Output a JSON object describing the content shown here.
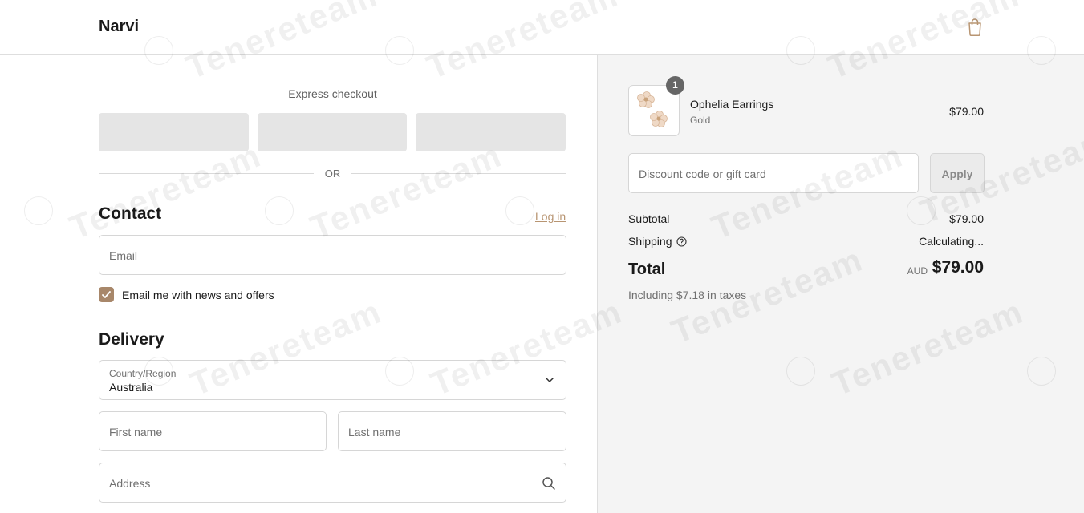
{
  "header": {
    "brand": "Narvi",
    "cart_icon": "shopping-bag-icon"
  },
  "express_checkout": {
    "title": "Express checkout",
    "divider_text": "OR"
  },
  "contact": {
    "title": "Contact",
    "login_link": "Log in",
    "email_placeholder": "Email",
    "newsletter_label": "Email me with news and offers",
    "newsletter_checked": true
  },
  "delivery": {
    "title": "Delivery",
    "country_label": "Country/Region",
    "country_value": "Australia",
    "first_name_placeholder": "First name",
    "last_name_placeholder": "Last name",
    "address_placeholder": "Address"
  },
  "summary": {
    "item": {
      "quantity": "1",
      "name": "Ophelia Earrings",
      "variant": "Gold",
      "price": "$79.00"
    },
    "discount_placeholder": "Discount code or gift card",
    "apply_label": "Apply",
    "subtotal_label": "Subtotal",
    "subtotal_value": "$79.00",
    "shipping_label": "Shipping",
    "shipping_value": "Calculating...",
    "total_label": "Total",
    "total_currency": "AUD",
    "total_value": "$79.00",
    "taxes_note": "Including $7.18 in taxes"
  },
  "colors": {
    "accent": "#b89572",
    "checkbox": "#a8876a",
    "panel": "#f4f4f4"
  },
  "watermark": "Tenereteam"
}
